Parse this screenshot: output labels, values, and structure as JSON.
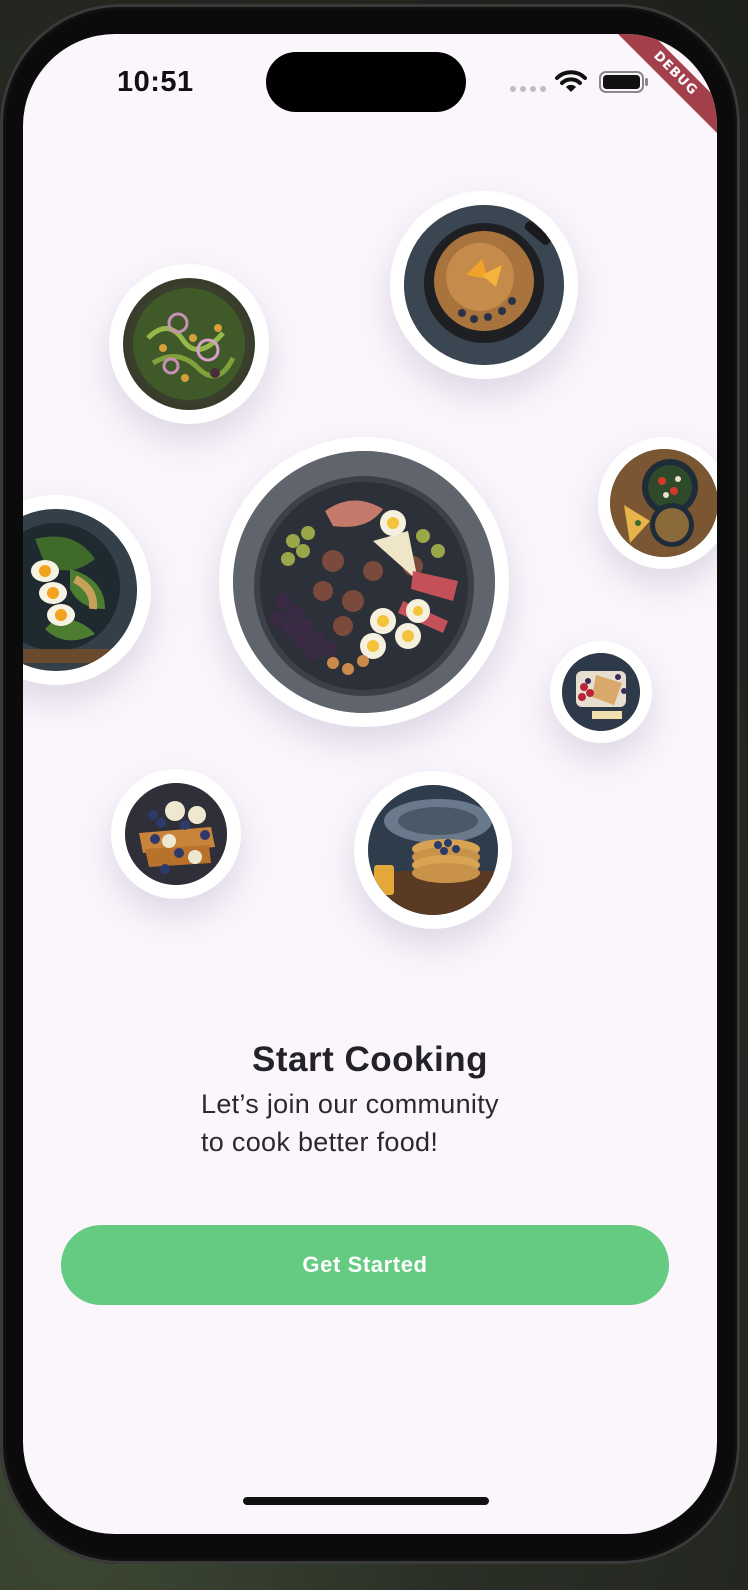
{
  "status_bar": {
    "time": "10:51",
    "debug_label": "DEBUG"
  },
  "icons": {
    "wifi": "wifi-icon",
    "battery": "battery-icon",
    "signal": "signal-dots-icon"
  },
  "colors": {
    "background": "#fbf6fc",
    "accent": "#65cb80",
    "debug_banner": "#a4404c",
    "title_text": "#23212a"
  },
  "dishes": [
    "salad-photo",
    "pancake-skillet-photo",
    "charcuterie-platter-photo",
    "egg-spinach-bowl-photo",
    "tomato-lentil-bowl-photo",
    "berry-toast-photo",
    "french-toast-berries-photo",
    "pancake-stack-photo"
  ],
  "onboarding": {
    "title": "Start Cooking",
    "subtitle_line1": "Let’s join our community",
    "subtitle_line2": "to cook better food!",
    "cta_label": "Get Started"
  }
}
